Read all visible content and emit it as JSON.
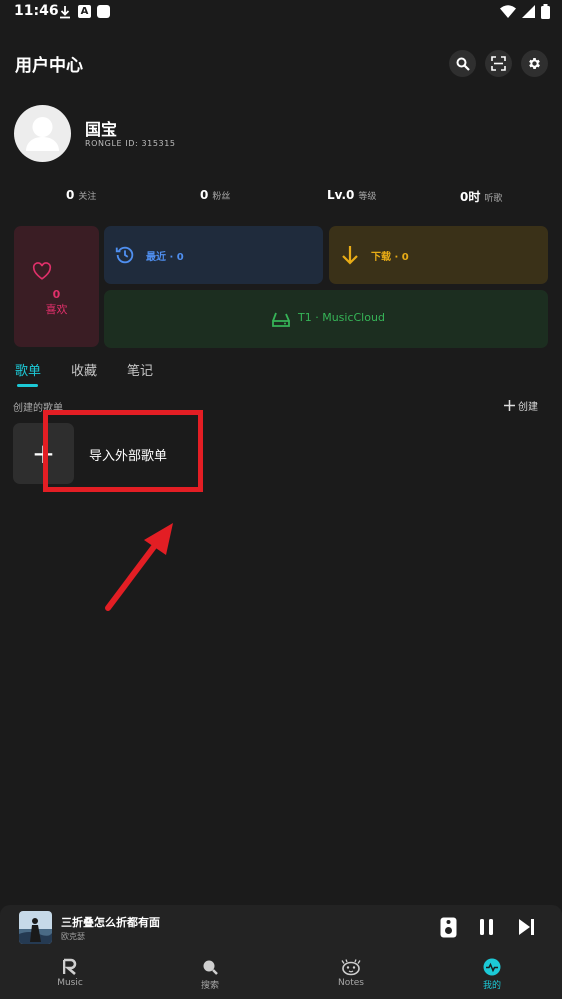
{
  "status_bar": {
    "time": "11:46",
    "notif_letter": "A"
  },
  "header": {
    "title": "用户中心"
  },
  "profile": {
    "name": "国宝",
    "user_id": "RONGLE  ID: 315315"
  },
  "stats": [
    {
      "value": "0",
      "label": "关注"
    },
    {
      "value": "0",
      "label": "粉丝"
    },
    {
      "value": "Lv.0",
      "label": "等级"
    },
    {
      "value": "0时",
      "label": "听歌"
    }
  ],
  "cards": {
    "like": {
      "count": "0",
      "label": "喜欢",
      "color": "#e0306a"
    },
    "recent": {
      "label": "最近 · 0",
      "color": "#4f8ff0"
    },
    "download": {
      "label": "下载 · 0",
      "color": "#e8ac16"
    },
    "cloud": {
      "label": "T1 · MusicCloud",
      "color": "#36b457"
    }
  },
  "tabs": [
    {
      "label": "歌单",
      "active": true
    },
    {
      "label": "收藏",
      "active": false
    },
    {
      "label": "笔记",
      "active": false
    }
  ],
  "playlists": {
    "section_title": "创建的歌单",
    "create_label": "创建",
    "import_label": "导入外部歌单",
    "import_glyph": "+"
  },
  "now_playing": {
    "title": "三折叠怎么折都有面",
    "artist": "欧克瑟"
  },
  "bottom_nav": [
    {
      "label": "Music",
      "icon": "music-r-icon",
      "active": false
    },
    {
      "label": "搜索",
      "icon": "search-icon",
      "active": false
    },
    {
      "label": "Notes",
      "icon": "notes-face-icon",
      "active": false
    },
    {
      "label": "我的",
      "icon": "profile-pulse-icon",
      "active": true
    }
  ],
  "colors": {
    "accent": "#1cc9d6",
    "annotation": "#e31e24",
    "background": "#1b1b1b"
  }
}
